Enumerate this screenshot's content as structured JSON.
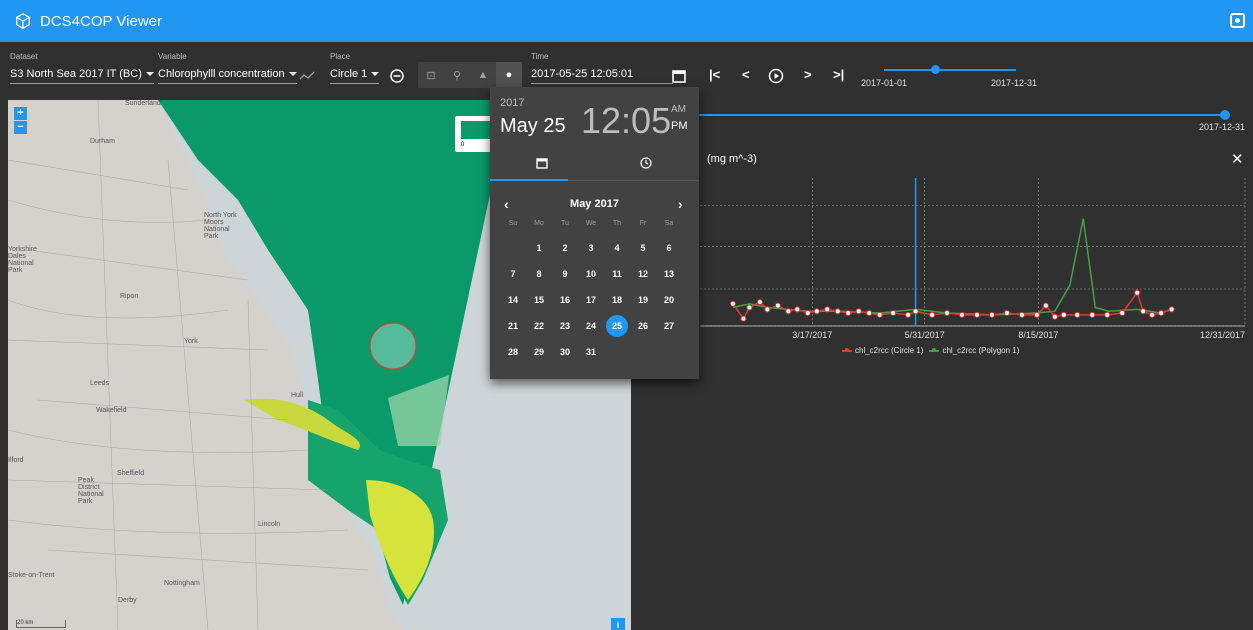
{
  "app": {
    "title": "DCS4COP Viewer"
  },
  "toolbar": {
    "dataset_label": "Dataset",
    "dataset_value": "S3 North Sea 2017 IT (BC)",
    "variable_label": "Variable",
    "variable_value": "Chlorophylll concentration",
    "place_label": "Place",
    "place_value": "Circle 1",
    "time_label": "Time",
    "time_value": "2017-05-25 12:05:01"
  },
  "time_slider": {
    "start_label": "2017-01-01",
    "end_label": "2017-12-31",
    "big_end_label": "2017-12-31"
  },
  "map": {
    "legend_min": "0",
    "labels": [
      "Durham",
      "North York Moors National Park",
      "Ripon",
      "York",
      "Leeds",
      "Wakefield",
      "Hull",
      "Sheffield",
      "Peak District National Park",
      "Lincoln",
      "Nottingham",
      "Derby",
      "Stoke-on-Trent",
      "Sunderland",
      "Ilford",
      "Yorkshire Dales National Park"
    ],
    "scale_label": "20 km",
    "info_label": "i"
  },
  "picker": {
    "year": "2017",
    "date": "May 25",
    "time": "12:05",
    "am": "AM",
    "pm": "PM",
    "month": "May 2017",
    "weekdays": [
      "Su",
      "Mo",
      "Tu",
      "We",
      "Th",
      "Fr",
      "Sa"
    ],
    "selected_day": 25,
    "first_weekday_index": 1,
    "days_in_month": 31
  },
  "chart_title_fragment": "(mg m^-3)",
  "chart_data": {
    "type": "line",
    "xlabel": "",
    "ylabel": "",
    "x_ticks": [
      "3/17/2017",
      "5/31/2017",
      "8/15/2017",
      "12/31/2017"
    ],
    "current_time_marker": "5/25/2017",
    "series": [
      {
        "name": "chl_c2rcc (Circle 1)",
        "color": "#e53935",
        "x": [
          "1/23",
          "1/30",
          "2/3",
          "2/10",
          "2/15",
          "2/22",
          "3/1",
          "3/7",
          "3/14",
          "3/20",
          "3/27",
          "4/3",
          "4/10",
          "4/17",
          "4/24",
          "5/1",
          "5/10",
          "5/20",
          "5/25",
          "6/5",
          "6/15",
          "6/25",
          "7/5",
          "7/15",
          "7/25",
          "8/4",
          "8/14",
          "8/20",
          "8/26",
          "9/1",
          "9/10",
          "9/20",
          "9/30",
          "10/10",
          "10/20",
          "10/24",
          "10/30",
          "11/5",
          "11/12"
        ],
        "y": [
          1.2,
          0.4,
          1.0,
          1.3,
          0.9,
          1.1,
          0.8,
          0.9,
          0.7,
          0.8,
          0.9,
          0.8,
          0.7,
          0.8,
          0.7,
          0.6,
          0.7,
          0.6,
          0.8,
          0.6,
          0.7,
          0.6,
          0.6,
          0.6,
          0.7,
          0.6,
          0.6,
          1.1,
          0.5,
          0.6,
          0.6,
          0.6,
          0.6,
          0.7,
          1.8,
          0.8,
          0.6,
          0.7,
          0.9
        ]
      },
      {
        "name": "chl_c2rcc (Polygon 1)",
        "color": "#43a047",
        "x": [
          "1/23",
          "2/3",
          "2/15",
          "3/1",
          "3/14",
          "4/3",
          "5/1",
          "5/25",
          "6/15",
          "7/15",
          "8/14",
          "8/26",
          "9/5",
          "9/14",
          "9/22",
          "10/1",
          "10/20",
          "11/5",
          "11/12"
        ],
        "y": [
          1.0,
          1.2,
          1.0,
          0.9,
          0.8,
          0.8,
          0.7,
          0.9,
          0.7,
          0.6,
          0.7,
          0.8,
          2.2,
          5.8,
          1.0,
          0.8,
          0.9,
          0.7,
          0.9
        ]
      }
    ]
  }
}
